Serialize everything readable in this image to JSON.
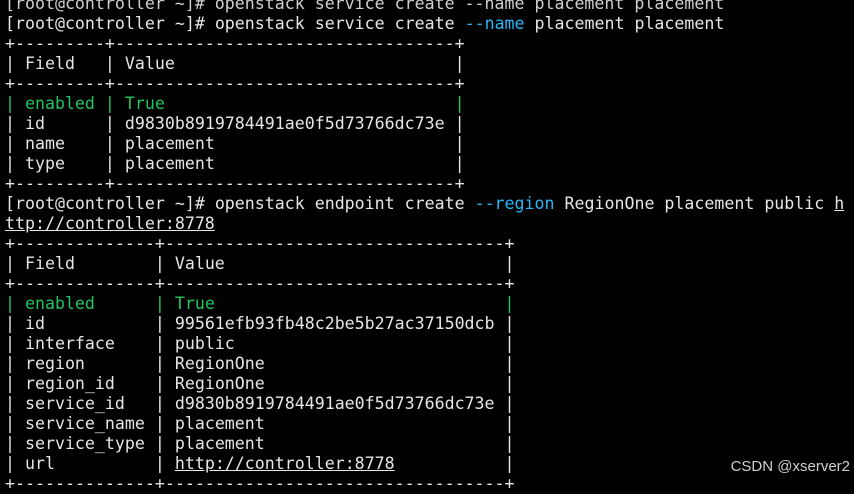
{
  "terminal": {
    "top_partial": "[root@controller ~]# openstack service create --name placement placement",
    "prompt": "[root@controller ~]#",
    "cmd1": {
      "base": "openstack service create",
      "flag": "--name",
      "args": "placement placement"
    },
    "table1": {
      "border": "+---------+----------------------------------+",
      "header_field": "Field",
      "header_value": "Value",
      "field_width": 7,
      "value_width": 32,
      "rows": [
        {
          "field": "enabled",
          "value": "True",
          "highlight": true
        },
        {
          "field": "id",
          "value": "d9830b8919784491ae0f5d73766dc73e"
        },
        {
          "field": "name",
          "value": "placement"
        },
        {
          "field": "type",
          "value": "placement"
        }
      ]
    },
    "cmd2": {
      "base": "openstack endpoint create",
      "flag": "--region",
      "args": "RegionOne placement public",
      "url_first": "h",
      "url_rest": "ttp://controller:8778"
    },
    "table2": {
      "border": "+--------------+----------------------------------+",
      "header_field": "Field",
      "header_value": "Value",
      "field_width": 12,
      "value_width": 32,
      "rows": [
        {
          "field": "enabled",
          "value": "True",
          "highlight": true
        },
        {
          "field": "id",
          "value": "99561efb93fb48c2be5b27ac37150dcb"
        },
        {
          "field": "interface",
          "value": "public"
        },
        {
          "field": "region",
          "value": "RegionOne"
        },
        {
          "field": "region_id",
          "value": "RegionOne"
        },
        {
          "field": "service_id",
          "value": "d9830b8919784491ae0f5d73766dc73e"
        },
        {
          "field": "service_name",
          "value": "placement"
        },
        {
          "field": "service_type",
          "value": "placement"
        },
        {
          "field": "url",
          "value": "http://controller:8778",
          "link": true
        }
      ]
    },
    "colors": {
      "background": "#000000",
      "text": "#e6e6e6",
      "highlight": "#22c55e",
      "flag": "#29b6f6"
    }
  },
  "watermark": "CSDN @xserver2"
}
